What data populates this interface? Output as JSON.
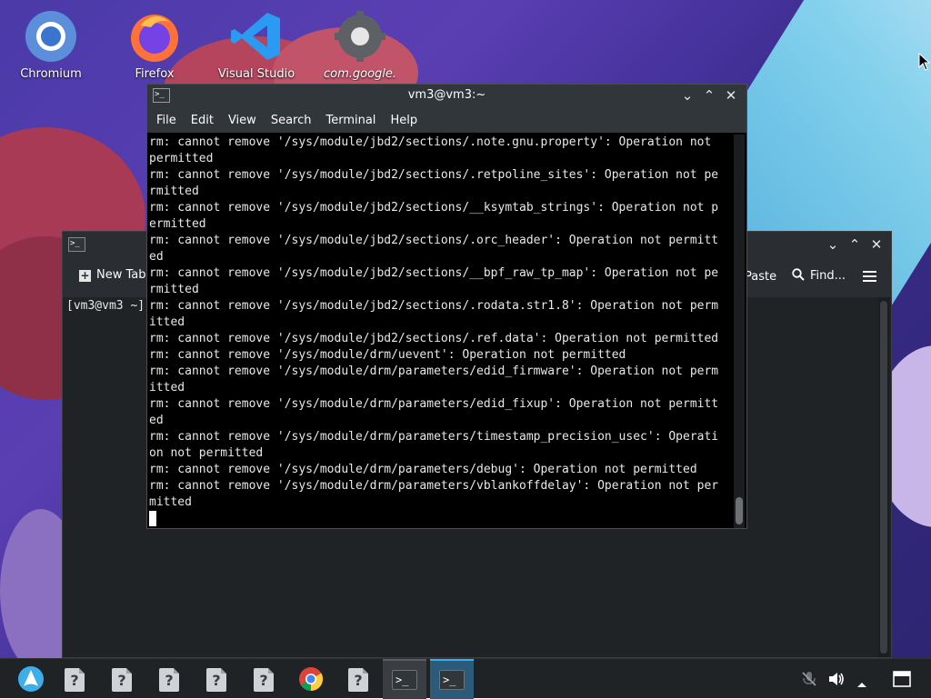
{
  "desktop": {
    "icons": [
      {
        "label": "Chromium"
      },
      {
        "label": "Firefox"
      },
      {
        "label": "Visual Studio"
      },
      {
        "label": "com.google."
      }
    ]
  },
  "back_window": {
    "new_tab_label": "New Tab",
    "paste_label": "Paste",
    "find_label": "Find...",
    "prompt": "[vm3@vm3 ~]"
  },
  "front_window": {
    "title": "vm3@vm3:~",
    "menu": [
      "File",
      "Edit",
      "View",
      "Search",
      "Terminal",
      "Help"
    ],
    "terminal_lines": [
      "rm: cannot remove '/sys/module/jbd2/sections/.note.gnu.property': Operation not",
      "permitted",
      "rm: cannot remove '/sys/module/jbd2/sections/.retpoline_sites': Operation not pe",
      "rmitted",
      "rm: cannot remove '/sys/module/jbd2/sections/__ksymtab_strings': Operation not p",
      "ermitted",
      "rm: cannot remove '/sys/module/jbd2/sections/.orc_header': Operation not permitt",
      "ed",
      "rm: cannot remove '/sys/module/jbd2/sections/__bpf_raw_tp_map': Operation not pe",
      "rmitted",
      "rm: cannot remove '/sys/module/jbd2/sections/.rodata.str1.8': Operation not perm",
      "itted",
      "rm: cannot remove '/sys/module/jbd2/sections/.ref.data': Operation not permitted",
      "rm: cannot remove '/sys/module/drm/uevent': Operation not permitted",
      "rm: cannot remove '/sys/module/drm/parameters/edid_firmware': Operation not perm",
      "itted",
      "rm: cannot remove '/sys/module/drm/parameters/edid_fixup': Operation not permitt",
      "ed",
      "rm: cannot remove '/sys/module/drm/parameters/timestamp_precision_usec': Operati",
      "on not permitted",
      "rm: cannot remove '/sys/module/drm/parameters/debug': Operation not permitted",
      "rm: cannot remove '/sys/module/drm/parameters/vblankoffdelay': Operation not per",
      "mitted"
    ]
  },
  "taskbar": {
    "items": [
      "app-launcher",
      "unknown-app",
      "unknown-app",
      "unknown-app",
      "unknown-app",
      "unknown-app",
      "chrome",
      "unknown-app",
      "konsole",
      "terminal"
    ],
    "unknown_glyph": "?"
  },
  "colors": {
    "accent": "#3daee9",
    "titlebar": "#31363b",
    "terminal_bg": "#000000"
  }
}
